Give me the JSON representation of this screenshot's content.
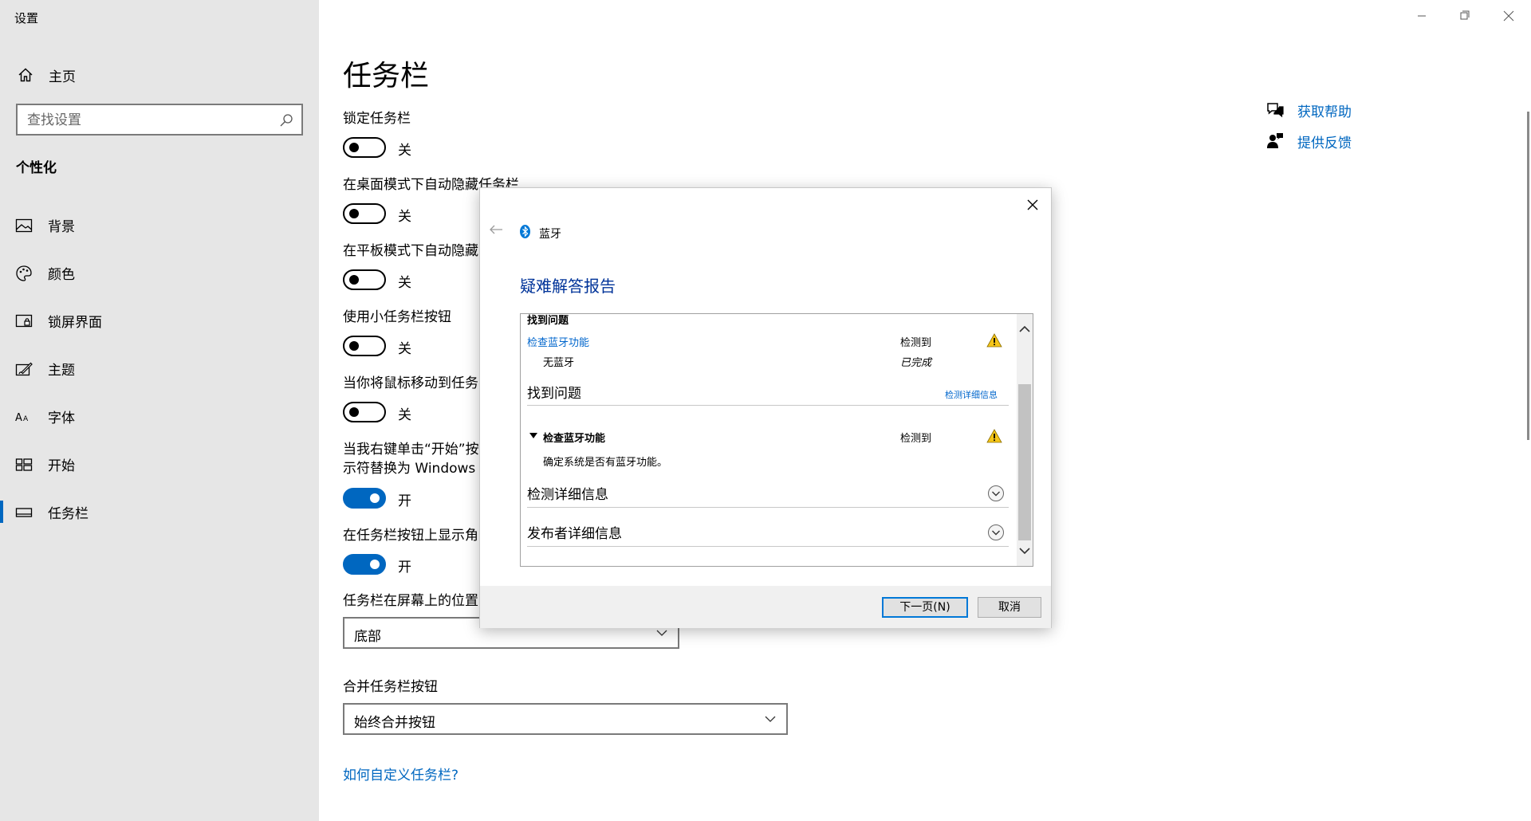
{
  "window": {
    "title": "设置"
  },
  "sidebar": {
    "home_label": "主页",
    "search_placeholder": "查找设置",
    "section_label": "个性化",
    "items": [
      {
        "label": "背景",
        "icon": "picture-icon"
      },
      {
        "label": "颜色",
        "icon": "palette-icon"
      },
      {
        "label": "锁屏界面",
        "icon": "lock-screen-icon"
      },
      {
        "label": "主题",
        "icon": "theme-brush-icon"
      },
      {
        "label": "字体",
        "icon": "font-icon"
      },
      {
        "label": "开始",
        "icon": "start-grid-icon"
      },
      {
        "label": "任务栏",
        "icon": "taskbar-icon",
        "active": true
      }
    ]
  },
  "main": {
    "title": "任务栏",
    "settings": [
      {
        "label": "锁定任务栏",
        "state": "关",
        "on": false
      },
      {
        "label": "在桌面模式下自动隐藏任务栏",
        "state": "关",
        "on": false
      },
      {
        "label": "在平板模式下自动隐藏",
        "state": "关",
        "on": false
      },
      {
        "label": "使用小任务栏按钮",
        "state": "关",
        "on": false
      },
      {
        "label": "当你将鼠标移动到任务",
        "state": "关",
        "on": false
      },
      {
        "label_line1": "当我右键单击“开始”按",
        "label_line2": "示符替换为 Windows P",
        "state": "开",
        "on": true
      },
      {
        "label": "在任务栏按钮上显示角",
        "state": "开",
        "on": true
      }
    ],
    "position_label": "任务栏在屏幕上的位置",
    "position_value": "底部",
    "combine_label": "合并任务栏按钮",
    "combine_value": "始终合并按钮",
    "customize_link": "如何自定义任务栏?",
    "help_link": "获取帮助",
    "feedback_link": "提供反馈"
  },
  "dialog": {
    "title": "蓝牙",
    "report_title": "疑难解答报告",
    "cut_header": "找到问题",
    "issue_link": "检查蓝牙功能",
    "issue_status": "检测到",
    "sub_item": "无蓝牙",
    "sub_status": "已完成",
    "section_header": "找到问题",
    "section_link": "检测详细信息",
    "detail_title": "检查蓝牙功能",
    "detail_status": "检测到",
    "detail_desc": "确定系统是否有蓝牙功能。",
    "expand1": "检测详细信息",
    "expand2": "发布者详细信息",
    "next_button": "下一页(N)",
    "cancel_button": "取消"
  },
  "colors": {
    "accent": "#0067c0",
    "dialog_link": "#0066cc",
    "dialog_heading": "#003399",
    "warning": "#f5c518"
  }
}
